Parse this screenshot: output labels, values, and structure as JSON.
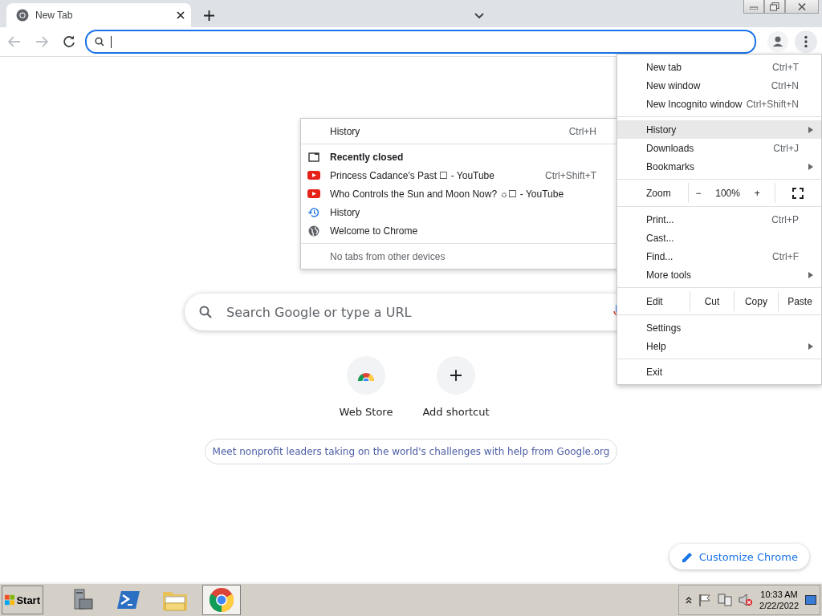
{
  "tabs": [
    {
      "title": "New Tab",
      "selected": true
    }
  ],
  "omnibox": {
    "focused": true
  },
  "new_tab_page": {
    "search": {
      "placeholder": "Search Google or type a URL"
    },
    "shortcuts": [
      {
        "kind": "web-store",
        "title": "Web Store"
      },
      {
        "kind": "add",
        "title": "Add shortcut"
      }
    ],
    "promo": "Meet nonprofit leaders taking on the world's challenges with help from Google.org",
    "customize_button": "Customize Chrome"
  },
  "menu": {
    "items": [
      {
        "kind": "item",
        "label": "New tab",
        "shortcut": "Ctrl+T",
        "submenu": false,
        "selected": false
      },
      {
        "kind": "item",
        "label": "New window",
        "shortcut": "Ctrl+N",
        "submenu": false,
        "selected": false
      },
      {
        "kind": "item",
        "label": "New Incognito window",
        "shortcut": "Ctrl+Shift+N",
        "submenu": false,
        "selected": false
      },
      {
        "kind": "separator"
      },
      {
        "kind": "item",
        "label": "History",
        "submenu": true,
        "selected": true
      },
      {
        "kind": "item",
        "label": "Downloads",
        "shortcut": "Ctrl+J",
        "submenu": false,
        "selected": false
      },
      {
        "kind": "item",
        "label": "Bookmarks",
        "submenu": true,
        "selected": false
      },
      {
        "kind": "separator"
      },
      {
        "kind": "zoom",
        "label": "Zoom",
        "minus": "−",
        "value": "100%",
        "plus": "+"
      },
      {
        "kind": "separator"
      },
      {
        "kind": "item",
        "label": "Print...",
        "shortcut": "Ctrl+P",
        "submenu": false,
        "selected": false
      },
      {
        "kind": "item",
        "label": "Cast...",
        "submenu": false,
        "selected": false
      },
      {
        "kind": "item",
        "label": "Find...",
        "shortcut": "Ctrl+F",
        "submenu": false,
        "selected": false
      },
      {
        "kind": "item",
        "label": "More tools",
        "submenu": true,
        "selected": false
      },
      {
        "kind": "separator"
      },
      {
        "kind": "edit",
        "label": "Edit",
        "actions": [
          "Cut",
          "Copy",
          "Paste"
        ]
      },
      {
        "kind": "separator"
      },
      {
        "kind": "item",
        "label": "Settings",
        "submenu": false,
        "selected": false
      },
      {
        "kind": "item",
        "label": "Help",
        "submenu": true,
        "selected": false
      },
      {
        "kind": "separator"
      },
      {
        "kind": "item",
        "label": "Exit",
        "submenu": false,
        "selected": false
      }
    ]
  },
  "history_submenu": {
    "items": [
      {
        "kind": "history-link",
        "label": "History",
        "shortcut": "Ctrl+H"
      },
      {
        "kind": "separator"
      },
      {
        "kind": "header",
        "label": "Recently closed"
      },
      {
        "kind": "youtube",
        "label": "Princess Cadance's Past ☐ - YouTube",
        "shortcut": "Ctrl+Shift+T"
      },
      {
        "kind": "youtube",
        "label": "Who Controls the Sun and Moon Now? ☼☐ - YouTube"
      },
      {
        "kind": "history-page",
        "label": "History"
      },
      {
        "kind": "web-page",
        "label": "Welcome to Chrome"
      },
      {
        "kind": "separator"
      },
      {
        "kind": "note",
        "label": "No tabs from other devices"
      }
    ]
  },
  "taskbar": {
    "start": "Start",
    "apps": [
      {
        "kind": "server-manager",
        "selected": false
      },
      {
        "kind": "powershell",
        "selected": false
      },
      {
        "kind": "explorer",
        "selected": false
      },
      {
        "kind": "chrome",
        "selected": true
      }
    ],
    "time": "10:33 AM",
    "date": "2/22/2022"
  }
}
